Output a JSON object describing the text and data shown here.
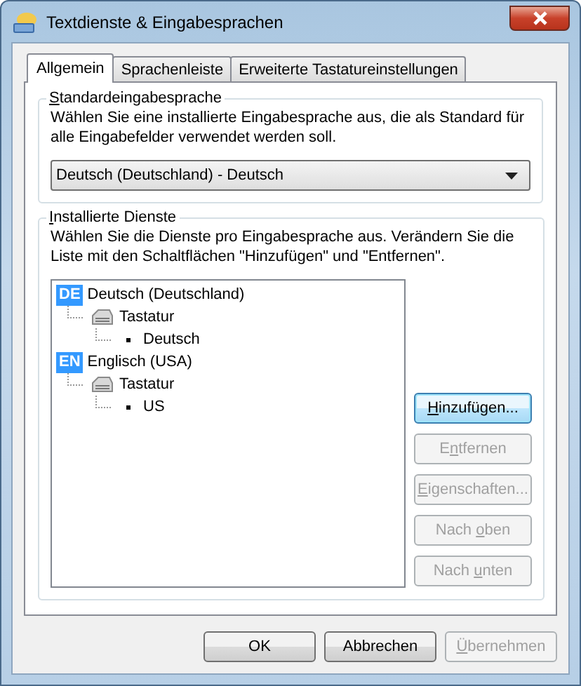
{
  "window": {
    "title": "Textdienste & Eingabesprachen"
  },
  "tabs": [
    {
      "label": "Allgemein",
      "selected": true
    },
    {
      "label": "Sprachenleiste",
      "selected": false
    },
    {
      "label": "Erweiterte Tastatureinstellungen",
      "selected": false
    }
  ],
  "default_language": {
    "label": "Standardeingabesprache",
    "description": "Wählen Sie eine installierte Eingabesprache aus, die als Standard für alle Eingabefelder verwendet werden soll.",
    "value": "Deutsch (Deutschland) - Deutsch"
  },
  "installed_services": {
    "label": "Installierte Dienste",
    "description": "Wählen Sie die Dienste pro Eingabesprache aus. Verändern Sie die Liste mit den Schaltflächen \"Hinzufügen\" und \"Entfernen\".",
    "tree": [
      {
        "kind": "language",
        "badge": "DE",
        "label": "Deutsch (Deutschland)",
        "children": [
          {
            "kind": "category",
            "label": "Tastatur",
            "children": [
              {
                "kind": "service",
                "label": "Deutsch"
              }
            ]
          }
        ]
      },
      {
        "kind": "language",
        "badge": "EN",
        "label": "Englisch (USA)",
        "children": [
          {
            "kind": "category",
            "label": "Tastatur",
            "children": [
              {
                "kind": "service",
                "label": "US"
              }
            ]
          }
        ]
      }
    ],
    "buttons": [
      {
        "label": "Hinzufügen...",
        "disabled": false,
        "default": true
      },
      {
        "label": "Entfernen",
        "disabled": true,
        "default": false
      },
      {
        "label": "Eigenschaften...",
        "disabled": true,
        "default": false
      },
      {
        "label": "Nach oben",
        "disabled": true,
        "default": false
      },
      {
        "label": "Nach unten",
        "disabled": true,
        "default": false
      }
    ]
  },
  "dialog_buttons": [
    {
      "label": "OK",
      "disabled": false
    },
    {
      "label": "Abbrechen",
      "disabled": false
    },
    {
      "label": "Übernehmen",
      "disabled": true
    }
  ]
}
